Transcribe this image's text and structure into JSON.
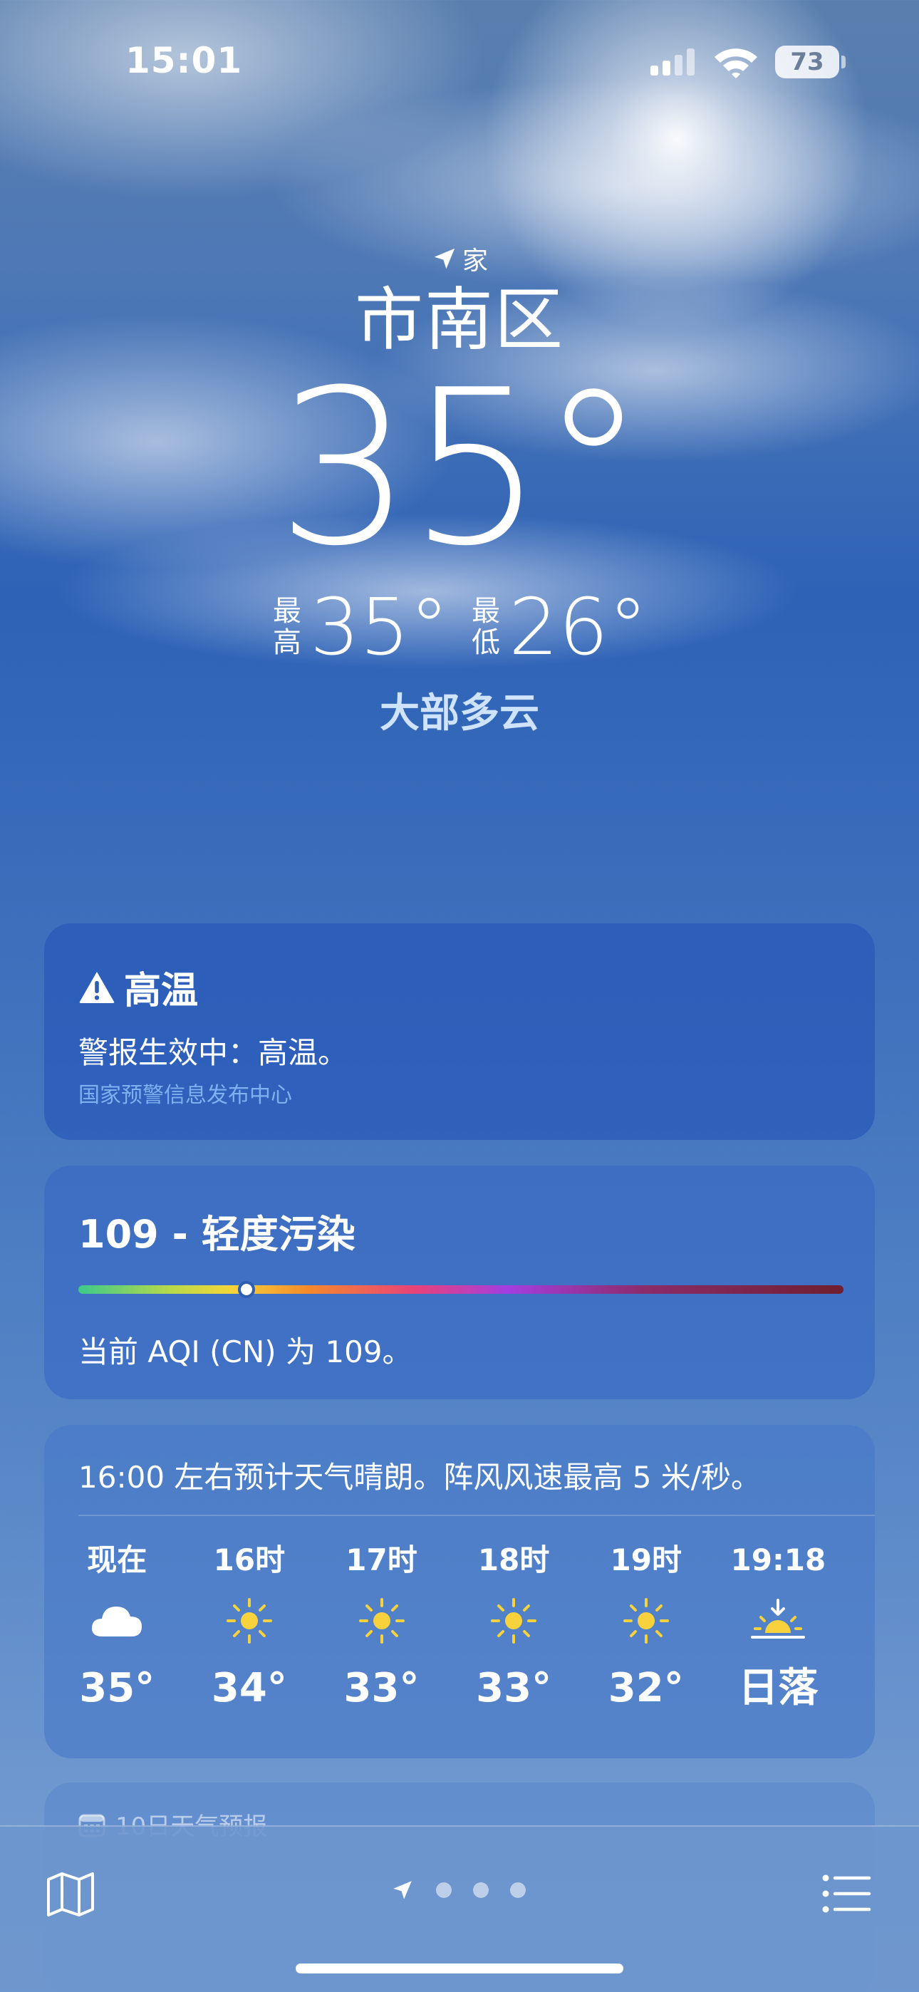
{
  "status": {
    "time": "15:01",
    "battery": "73"
  },
  "location": {
    "tag": "家",
    "city": "市南区"
  },
  "current": {
    "temp": "35°",
    "high_label": "最高",
    "high": "35°",
    "low_label": "最低",
    "low": "26°",
    "condition": "大部多云"
  },
  "alert": {
    "title": "高温",
    "text": "警报生效中：高温。",
    "source": "国家预警信息发布中心"
  },
  "aqi": {
    "title": "109 - 轻度污染",
    "text": "当前 AQI (CN) 为 109。",
    "level_fraction": 0.22
  },
  "hourly": {
    "summary": "16:00 左右预计天气晴朗。阵风风速最高 5 米/秒。",
    "items": [
      {
        "label": "现在",
        "icon": "cloud-icon",
        "temp": "35°"
      },
      {
        "label": "16时",
        "icon": "sun-icon",
        "temp": "34°"
      },
      {
        "label": "17时",
        "icon": "sun-icon",
        "temp": "33°"
      },
      {
        "label": "18时",
        "icon": "sun-icon",
        "temp": "33°"
      },
      {
        "label": "19时",
        "icon": "sun-icon",
        "temp": "32°"
      },
      {
        "label": "19:18",
        "icon": "sunset-icon",
        "temp": "日落"
      }
    ]
  },
  "tenday": {
    "title": "10日天气预报"
  },
  "colors": {
    "accent": "#cfe3ff",
    "sun": "#f7d23c",
    "alert_source": "#7fb0f0"
  }
}
